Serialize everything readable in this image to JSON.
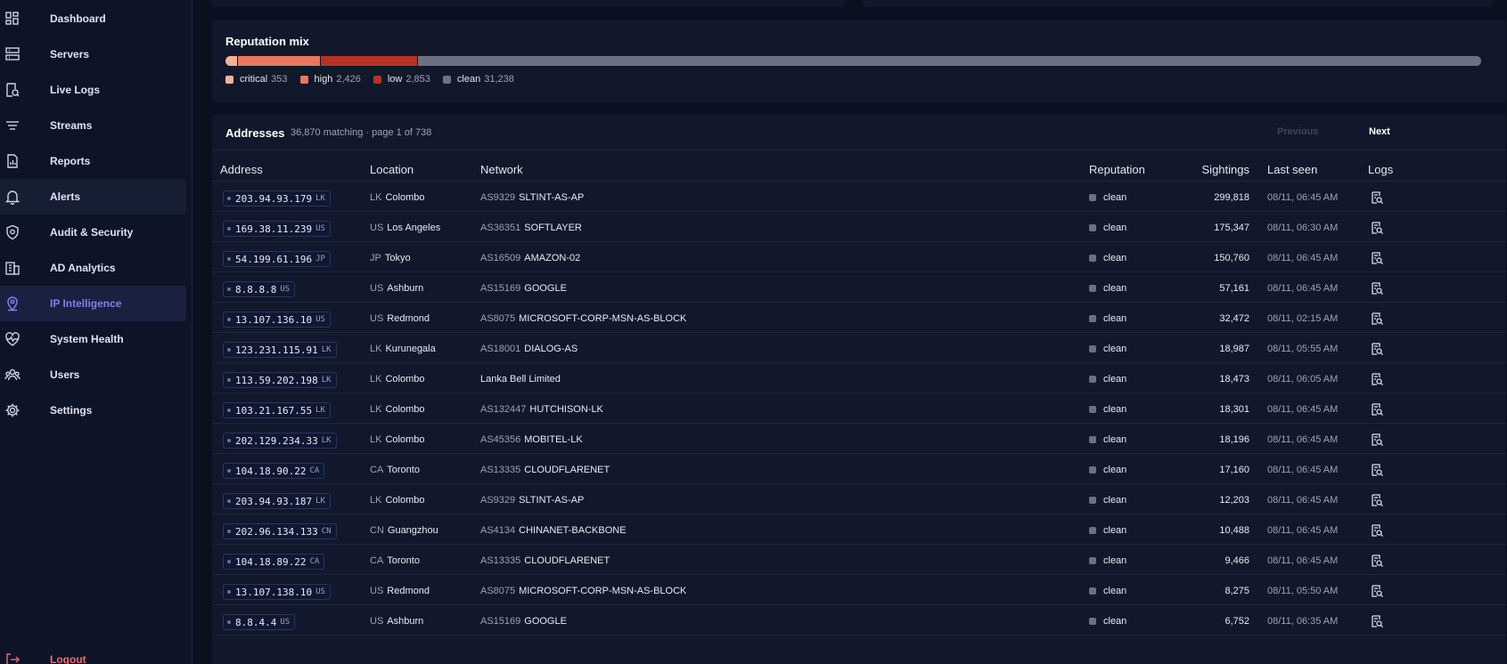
{
  "sidebar": {
    "items": [
      {
        "label": "Dashboard",
        "icon": "dashboard-icon"
      },
      {
        "label": "Servers",
        "icon": "servers-icon"
      },
      {
        "label": "Live Logs",
        "icon": "live-logs-icon"
      },
      {
        "label": "Streams",
        "icon": "streams-icon"
      },
      {
        "label": "Reports",
        "icon": "reports-icon"
      },
      {
        "label": "Alerts",
        "icon": "bell-icon"
      },
      {
        "label": "Audit & Security",
        "icon": "shield-icon"
      },
      {
        "label": "AD Analytics",
        "icon": "building-icon"
      },
      {
        "label": "IP Intelligence",
        "icon": "map-pin-icon"
      },
      {
        "label": "System Health",
        "icon": "heartbeat-icon"
      },
      {
        "label": "Users",
        "icon": "users-icon"
      },
      {
        "label": "Settings",
        "icon": "gear-icon"
      }
    ],
    "logout_label": "Logout",
    "active_item": "IP Intelligence"
  },
  "reputation": {
    "title": "Reputation mix",
    "segments": [
      {
        "label": "critical",
        "value": "353",
        "count": 353,
        "color": "#f4b19a"
      },
      {
        "label": "high",
        "value": "2,426",
        "count": 2426,
        "color": "#e8775e"
      },
      {
        "label": "low",
        "value": "2,853",
        "count": 2853,
        "color": "#b83223"
      },
      {
        "label": "clean",
        "value": "31,238",
        "count": 31238,
        "color": "#6b7180"
      }
    ]
  },
  "addresses": {
    "title": "Addresses",
    "meta": "36,870 matching · page 1 of 738",
    "prev_label": "Previous",
    "next_label": "Next",
    "columns": {
      "address": "Address",
      "location": "Location",
      "network": "Network",
      "reputation": "Reputation",
      "sightings": "Sightings",
      "last_seen": "Last seen",
      "logs": "Logs"
    },
    "rows": [
      {
        "ip": "203.94.93.179",
        "ip_cc": "LK",
        "cc": "LK",
        "city": "Colombo",
        "asn": "AS9329",
        "net": "SLTINT-AS-AP",
        "rep": "clean",
        "sightings": "299,818",
        "seen": "08/11, 06:45 AM"
      },
      {
        "ip": "169.38.11.239",
        "ip_cc": "US",
        "cc": "US",
        "city": "Los Angeles",
        "asn": "AS36351",
        "net": "SOFTLAYER",
        "rep": "clean",
        "sightings": "175,347",
        "seen": "08/11, 06:30 AM"
      },
      {
        "ip": "54.199.61.196",
        "ip_cc": "JP",
        "cc": "JP",
        "city": "Tokyo",
        "asn": "AS16509",
        "net": "AMAZON-02",
        "rep": "clean",
        "sightings": "150,760",
        "seen": "08/11, 06:45 AM"
      },
      {
        "ip": "8.8.8.8",
        "ip_cc": "US",
        "cc": "US",
        "city": "Ashburn",
        "asn": "AS15169",
        "net": "GOOGLE",
        "rep": "clean",
        "sightings": "57,161",
        "seen": "08/11, 06:45 AM"
      },
      {
        "ip": "13.107.136.10",
        "ip_cc": "US",
        "cc": "US",
        "city": "Redmond",
        "asn": "AS8075",
        "net": "MICROSOFT-CORP-MSN-AS-BLOCK",
        "rep": "clean",
        "sightings": "32,472",
        "seen": "08/11, 02:15 AM"
      },
      {
        "ip": "123.231.115.91",
        "ip_cc": "LK",
        "cc": "LK",
        "city": "Kurunegala",
        "asn": "AS18001",
        "net": "DIALOG-AS",
        "rep": "clean",
        "sightings": "18,987",
        "seen": "08/11, 05:55 AM"
      },
      {
        "ip": "113.59.202.198",
        "ip_cc": "LK",
        "cc": "LK",
        "city": "Colombo",
        "asn": "",
        "net": "Lanka Bell Limited",
        "rep": "clean",
        "sightings": "18,473",
        "seen": "08/11, 06:05 AM"
      },
      {
        "ip": "103.21.167.55",
        "ip_cc": "LK",
        "cc": "LK",
        "city": "Colombo",
        "asn": "AS132447",
        "net": "HUTCHISON-LK",
        "rep": "clean",
        "sightings": "18,301",
        "seen": "08/11, 06:45 AM"
      },
      {
        "ip": "202.129.234.33",
        "ip_cc": "LK",
        "cc": "LK",
        "city": "Colombo",
        "asn": "AS45356",
        "net": "MOBITEL-LK",
        "rep": "clean",
        "sightings": "18,196",
        "seen": "08/11, 06:45 AM"
      },
      {
        "ip": "104.18.90.22",
        "ip_cc": "CA",
        "cc": "CA",
        "city": "Toronto",
        "asn": "AS13335",
        "net": "CLOUDFLARENET",
        "rep": "clean",
        "sightings": "17,160",
        "seen": "08/11, 06:45 AM"
      },
      {
        "ip": "203.94.93.187",
        "ip_cc": "LK",
        "cc": "LK",
        "city": "Colombo",
        "asn": "AS9329",
        "net": "SLTINT-AS-AP",
        "rep": "clean",
        "sightings": "12,203",
        "seen": "08/11, 06:45 AM"
      },
      {
        "ip": "202.96.134.133",
        "ip_cc": "CN",
        "cc": "CN",
        "city": "Guangzhou",
        "asn": "AS4134",
        "net": "CHINANET-BACKBONE",
        "rep": "clean",
        "sightings": "10,488",
        "seen": "08/11, 06:45 AM"
      },
      {
        "ip": "104.18.89.22",
        "ip_cc": "CA",
        "cc": "CA",
        "city": "Toronto",
        "asn": "AS13335",
        "net": "CLOUDFLARENET",
        "rep": "clean",
        "sightings": "9,466",
        "seen": "08/11, 06:45 AM"
      },
      {
        "ip": "13.107.138.10",
        "ip_cc": "US",
        "cc": "US",
        "city": "Redmond",
        "asn": "AS8075",
        "net": "MICROSOFT-CORP-MSN-AS-BLOCK",
        "rep": "clean",
        "sightings": "8,275",
        "seen": "08/11, 05:50 AM"
      },
      {
        "ip": "8.8.4.4",
        "ip_cc": "US",
        "cc": "US",
        "city": "Ashburn",
        "asn": "AS15169",
        "net": "GOOGLE",
        "rep": "clean",
        "sightings": "6,752",
        "seen": "08/11, 06:35 AM"
      }
    ]
  }
}
